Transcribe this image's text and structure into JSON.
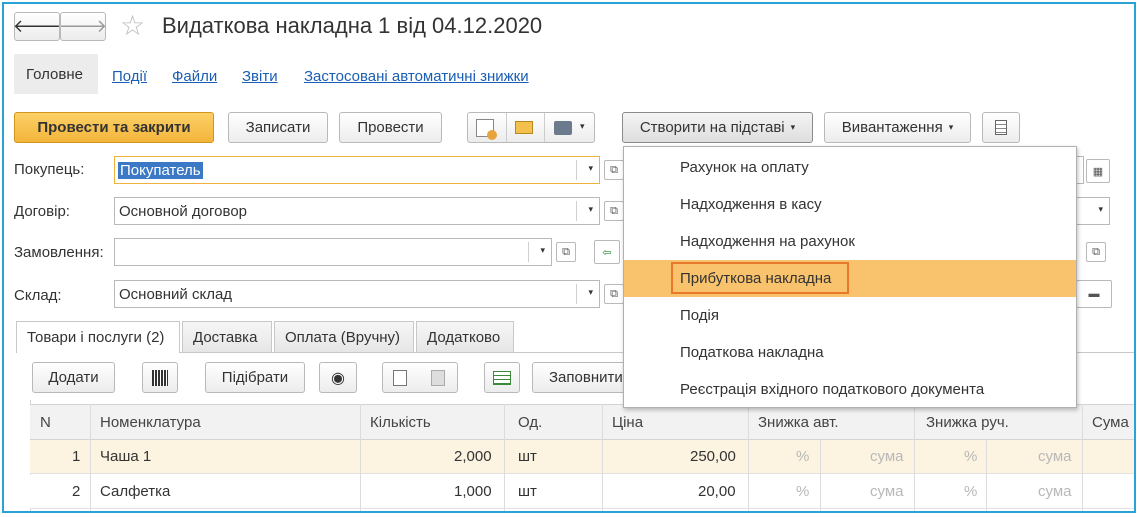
{
  "window": {
    "title": "Видаткова накладна 1 від 04.12.2020",
    "back_glyph": "🡐",
    "forward_glyph": "🡒"
  },
  "nav": {
    "main": "Головне",
    "links": [
      "Події",
      "Файли",
      "Звіти",
      "Застосовані автоматичні знижки"
    ]
  },
  "toolbar": {
    "post_close": "Провести та закрити",
    "save": "Записати",
    "post": "Провести",
    "create_based": "Створити на підставі",
    "export": "Вивантаження"
  },
  "fields": {
    "buyer_label": "Покупець:",
    "buyer_value": "Покупатель",
    "contract_label": "Договір:",
    "contract_value": "Основной договор",
    "order_label": "Замовлення:",
    "order_value": "",
    "warehouse_label": "Склад:",
    "warehouse_value": "Основний склад"
  },
  "menu": {
    "items": [
      "Рахунок на оплату",
      "Надходження в касу",
      "Надходження на рахунок",
      "Прибуткова накладна",
      "Подія",
      "Податкова накладна",
      "Реєстрація вхідного податкового документа"
    ],
    "highlighted_index": 3,
    "highlight_color": "#f8c36c",
    "outline_color": "#e8792b"
  },
  "tabs": [
    "Товари і послуги (2)",
    "Доставка",
    "Оплата (Вручну)",
    "Додатково"
  ],
  "table_toolbar": {
    "add": "Додати",
    "select": "Підібрати",
    "fill": "Заповнити"
  },
  "table": {
    "columns": [
      "N",
      "Номенклатура",
      "Кількість",
      "Од.",
      "Ціна",
      "Знижка авт.",
      "Знижка руч.",
      "Сума"
    ],
    "rows": [
      {
        "n": "1",
        "item": "Чаша 1",
        "qty": "2,000",
        "unit": "шт",
        "price": "250,00",
        "auto_pct": "%",
        "auto_sum": "сума",
        "man_pct": "%",
        "man_sum": "сума"
      },
      {
        "n": "2",
        "item": "Салфетка",
        "qty": "1,000",
        "unit": "шт",
        "price": "20,00",
        "auto_pct": "%",
        "auto_sum": "сума",
        "man_pct": "%",
        "man_sum": "сума"
      }
    ]
  },
  "colors": {
    "frame": "#29a3d6",
    "primary_button": "#f3b53b",
    "selected_row": "#fdf3e1"
  }
}
